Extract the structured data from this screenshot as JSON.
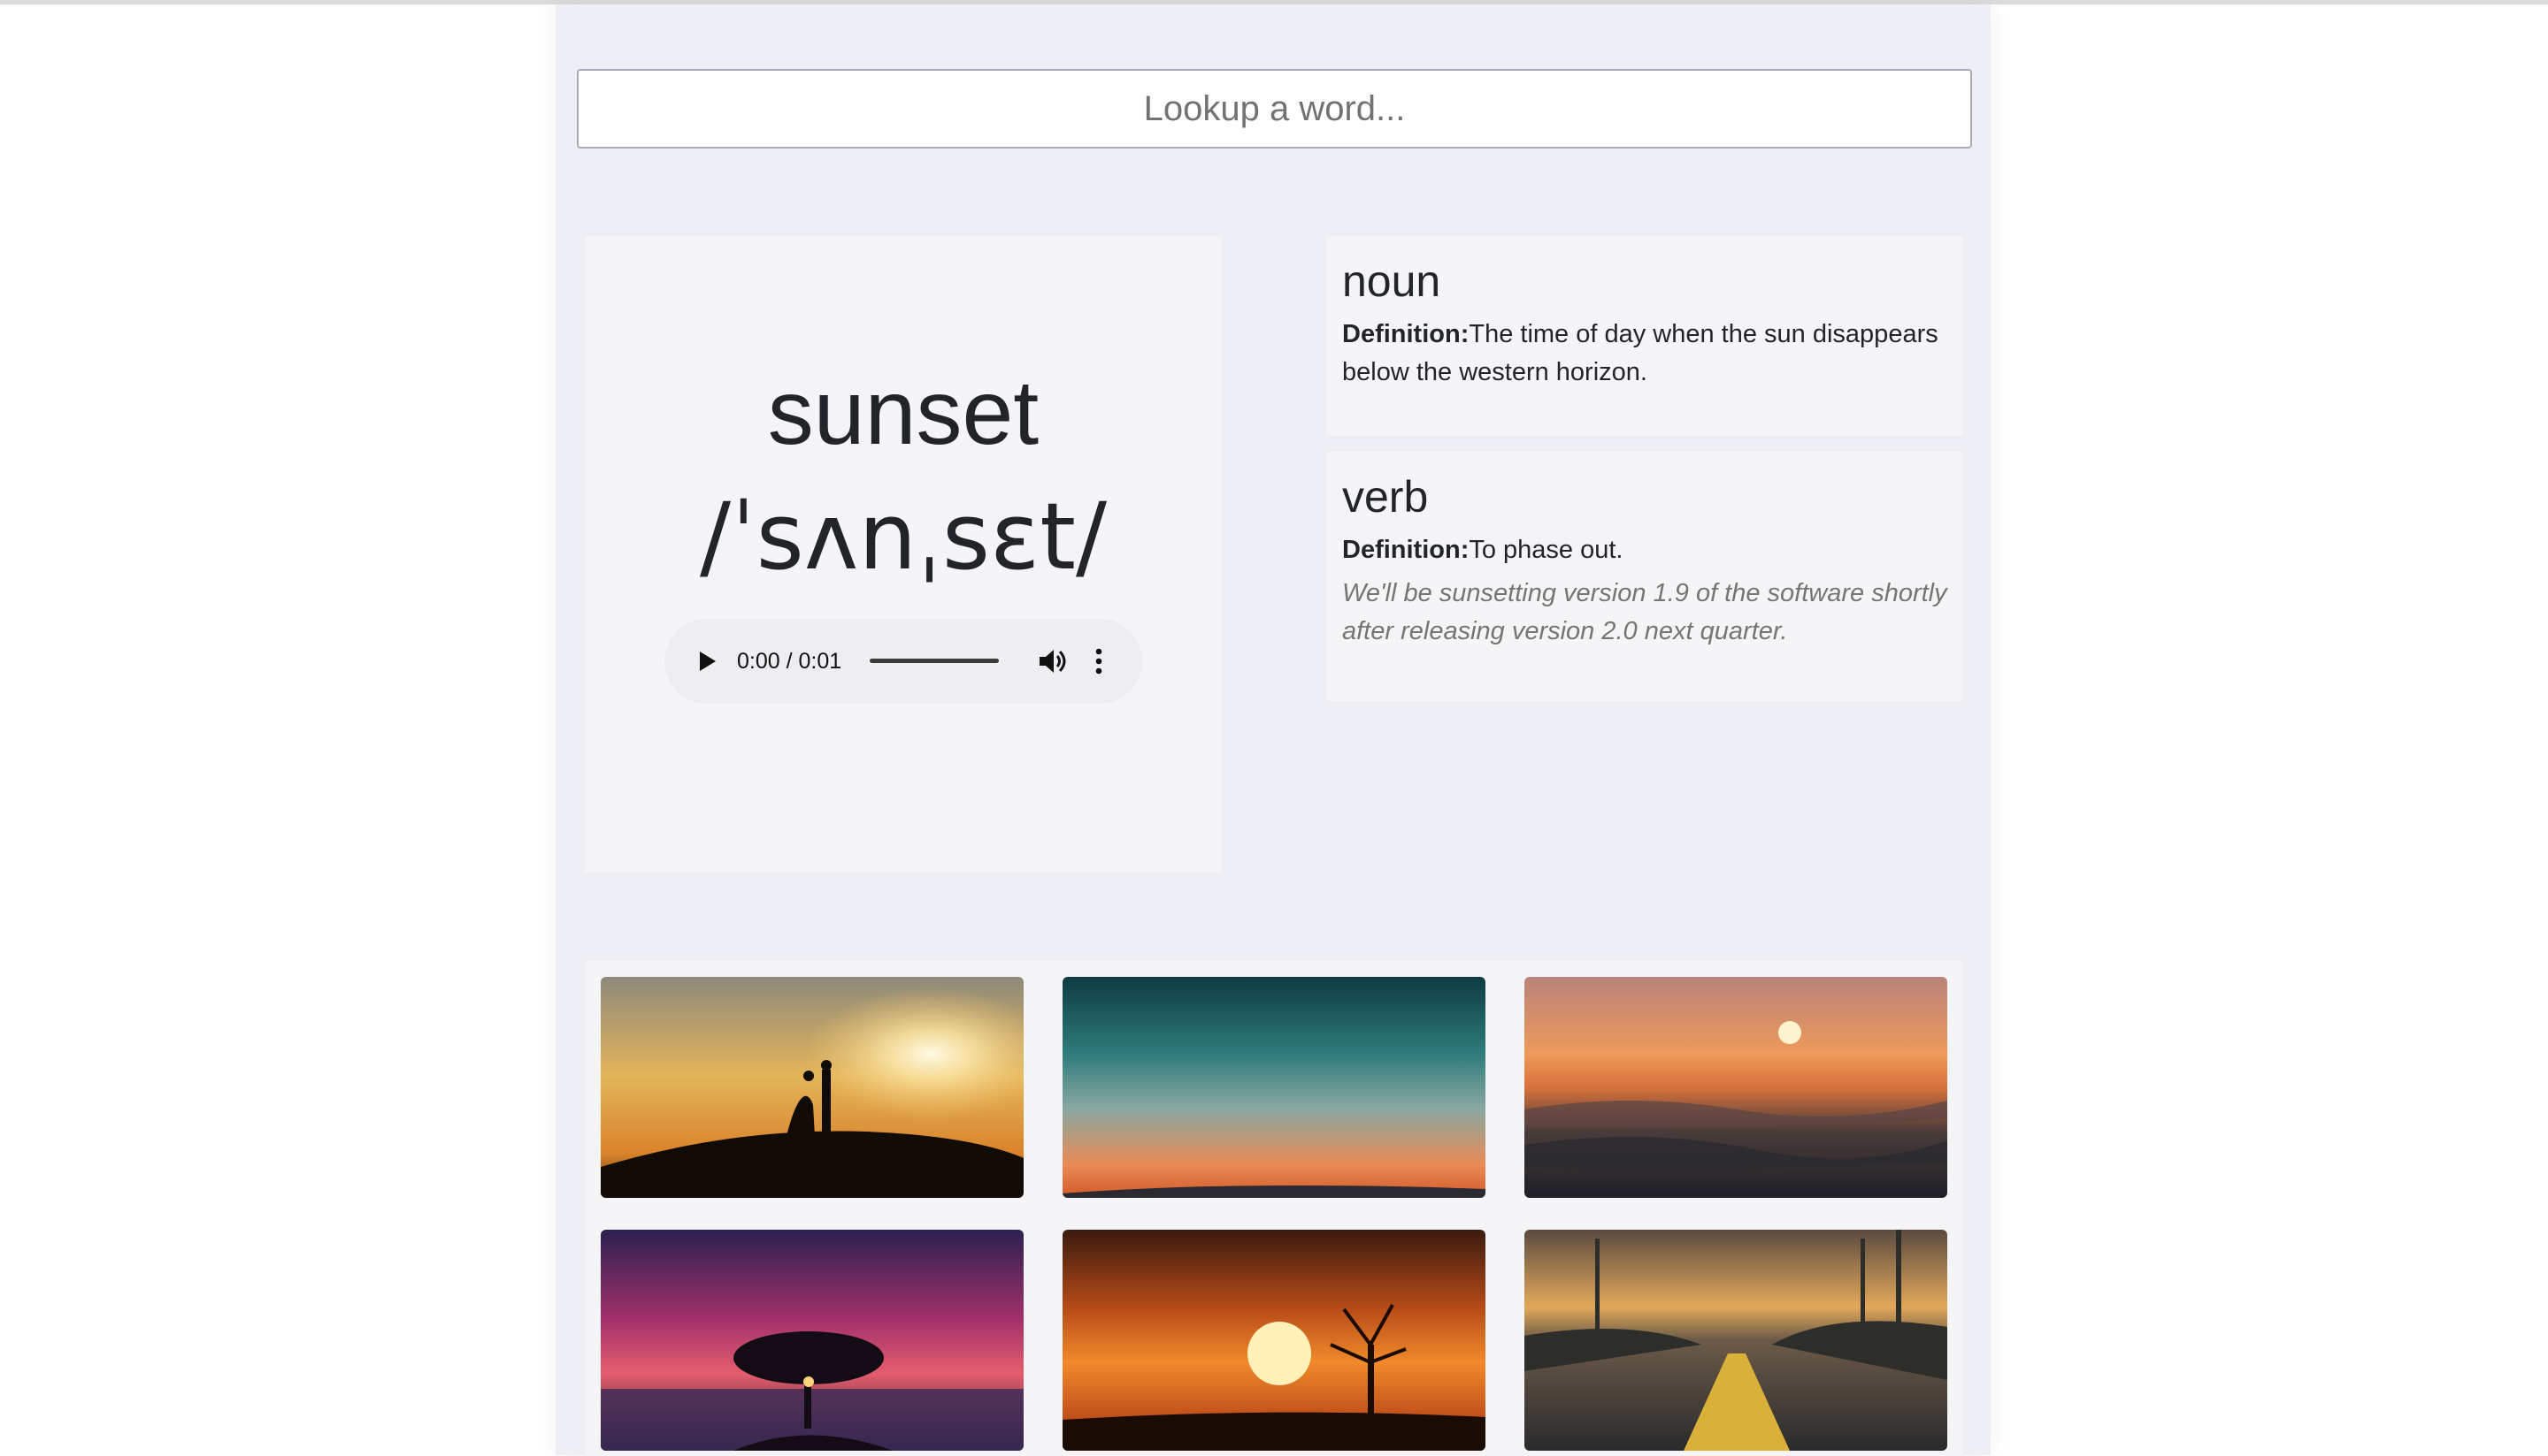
{
  "search": {
    "placeholder": "Lookup a word..."
  },
  "entry": {
    "word": "sunset",
    "phonetic": "/ˈsʌnˌsɛt/",
    "audio": {
      "time": "0:00 / 0:01"
    }
  },
  "meanings": [
    {
      "part_of_speech": "noun",
      "definition_label": "Definition:",
      "definition": "The time of day when the sun disappears below the western horizon."
    },
    {
      "part_of_speech": "verb",
      "definition_label": "Definition:",
      "definition": "To phase out.",
      "example": "We'll be sunsetting version 1.9 of the software shortly after releasing version 2.0 next quarter."
    }
  ],
  "gallery": {
    "images": [
      {
        "subject": "couple silhouette on hill at sunset"
      },
      {
        "subject": "teal and orange sky"
      },
      {
        "subject": "sun over ocean waves"
      },
      {
        "subject": "tree silhouette under purple sky"
      },
      {
        "subject": "sun with bare tree and birds"
      },
      {
        "subject": "road with palm trees at dusk"
      }
    ]
  }
}
